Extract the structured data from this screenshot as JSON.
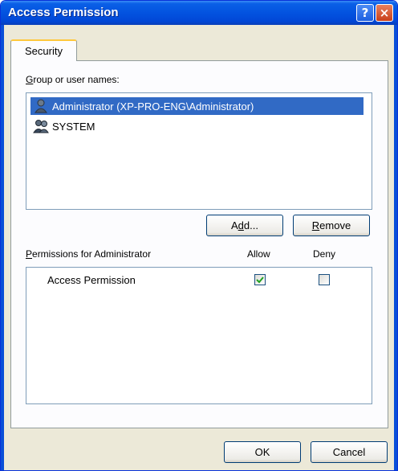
{
  "window": {
    "title": "Access Permission",
    "help_glyph": "?",
    "close_glyph": "×"
  },
  "tabs": [
    {
      "label": "Security",
      "active": true
    }
  ],
  "groups": {
    "label_prefix": "G",
    "label_rest": "roup or user names:",
    "items": [
      {
        "label": "Administrator (XP-PRO-ENG\\Administrator)",
        "selected": true,
        "icon": "user-icon"
      },
      {
        "label": "SYSTEM",
        "selected": false,
        "icon": "group-icon"
      }
    ]
  },
  "buttons": {
    "add_prefix": "A",
    "add_mnemonic": "d",
    "add_rest": "d...",
    "remove_mnemonic": "R",
    "remove_rest": "emove",
    "ok": "OK",
    "cancel": "Cancel"
  },
  "permissions": {
    "label_prefix": "P",
    "label_rest": "ermissions for Administrator",
    "allow_header": "Allow",
    "deny_header": "Deny",
    "rows": [
      {
        "name": "Access Permission",
        "allow": true,
        "deny": false
      }
    ]
  },
  "colors": {
    "titlebar": "#0353e0",
    "selection": "#316ac5",
    "window_bg": "#ece9d8",
    "panel_bg": "#fcfcfe",
    "check": "#21a121"
  }
}
